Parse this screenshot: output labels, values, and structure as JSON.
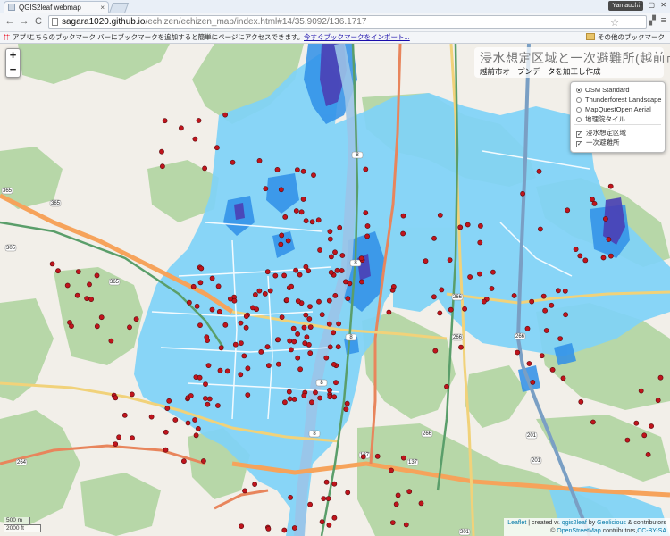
{
  "browser": {
    "tab_title": "QGIS2leaf webmap",
    "tab_close": "×",
    "user_badge": "Yamauchi",
    "window_controls": "—  ▢  ✕",
    "back": "←",
    "forward": "→",
    "reload": "C",
    "url_host": "sagara1020.github.io",
    "url_path": "/echizen/echizen_map/index.html#14/35.9092/136.1717",
    "star": "☆",
    "menu": "≡"
  },
  "bookmarks": {
    "apps_label": "アプリ",
    "message": "こちらのブックマーク バーにブックマークを追加すると簡単にページにアクセスできます。",
    "import_link": "今すぐブックマークをインポート...",
    "other_label": "その他のブックマーク"
  },
  "map": {
    "zoom_in": "+",
    "zoom_out": "−",
    "title": "浸水想定区域と一次避難所(越前市)",
    "subtitle": "越前市オープンデータを加工し作成",
    "base_layers": [
      {
        "label": "OSM Standard",
        "selected": true
      },
      {
        "label": "Thunderforest Landscape",
        "selected": false
      },
      {
        "label": "MapQuestOpen Aerial",
        "selected": false
      },
      {
        "label": "地理院タイル",
        "selected": false
      }
    ],
    "overlays": [
      {
        "label": "浸水想定区域",
        "checked": true
      },
      {
        "label": "一次避難所",
        "checked": true
      }
    ],
    "check_mark": "✓",
    "scale_metric": "500 m",
    "scale_imperial": "2000 ft",
    "attribution_line1_link1": "Leaflet",
    "attribution_line1_mid": " | created w. ",
    "attribution_line1_link2": "qgis2leaf",
    "attribution_line1_by": " by ",
    "attribution_line1_link3": "Geolicious",
    "attribution_line1_end": " & contributors",
    "attribution_line2_pre": "© ",
    "attribution_line2_link1": "OpenStreetMap",
    "attribution_line2_mid": " contributors,",
    "attribution_line2_link2": "CC-BY-SA",
    "road_labels": [
      "365",
      "365",
      "305",
      "365",
      "8",
      "8",
      "8",
      "8",
      "8",
      "137",
      "137",
      "266",
      "266",
      "266",
      "266",
      "201",
      "201",
      "201",
      "264"
    ],
    "colors": {
      "flood_light": "#7fd3f7",
      "flood_mid": "#2f8fe8",
      "flood_deep": "#4a3fb5",
      "shelter": "#c0141c",
      "forest": "#b7d7a8",
      "river": "#9bc4e8",
      "rail": "#5a9e6a",
      "highway": "#f6a35b"
    }
  }
}
